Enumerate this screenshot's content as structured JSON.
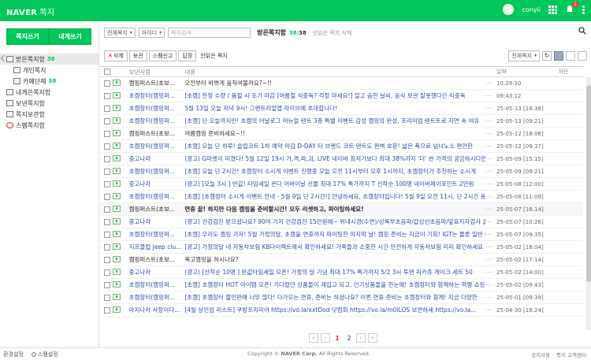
{
  "header": {
    "logo": "NAVER",
    "service": "쪽지",
    "username": "conyii",
    "notification_count": "1",
    "app_icon": "grid-icon"
  },
  "sidebar": {
    "send_label": "쪽지쓰기",
    "self_label": "내게쓰기",
    "folders": [
      {
        "label": "받은쪽지함",
        "count": "38",
        "icon": "inbox-icon",
        "indent": 0,
        "selected": true
      },
      {
        "label": "개인쪽지",
        "count": "",
        "icon": "person-icon",
        "indent": 1
      },
      {
        "label": "카페단체",
        "count": "38",
        "icon": "group-icon",
        "indent": 1
      },
      {
        "label": "내게쓴쪽지함",
        "count": "",
        "icon": "self-icon",
        "indent": 0
      },
      {
        "label": "보낸쪽지함",
        "count": "",
        "icon": "sent-icon",
        "indent": 0
      },
      {
        "label": "쪽지보관함",
        "count": "",
        "icon": "archive-icon",
        "indent": 0
      },
      {
        "label": "스팸쪽지함",
        "count": "",
        "icon": "spam-icon",
        "indent": 0
      }
    ],
    "footer_settings": "환경설정",
    "footer_block": "스팸설정"
  },
  "filter": {
    "folder_select": "전체쪽지",
    "type_select": "아이디",
    "search_placeholder": "쪽지검색",
    "folder_title": "받은쪽지함",
    "unread": "38",
    "total": "38",
    "tip": "안읽은 쪽지 삭제"
  },
  "toolbar": {
    "delete_label": "삭제",
    "save_label": "보관",
    "spam_label": "스팸신고",
    "reply_label": "답장",
    "unread_label": "안읽은 쪽지",
    "view_select": "전체쪽지"
  },
  "table": {
    "headers": {
      "from": "보낸사람",
      "body": "내용",
      "date": "날짜",
      "block": "차단"
    },
    "rows": [
      {
        "from": "캠핑퍼스트(초보...",
        "body": "오전부터 바쁘게 움직여볼까요?~!!",
        "date": "10:29:10",
        "type": "shop"
      },
      {
        "from": "초캠장터(캠핑퍼...",
        "body": "[초캠] 한정 수량 / 품절 시 조기 마감 [여름철 식중독? 걱정 마세요!] 얼고 숨한 날씨, 음식 보관 잘못했다간 식중독",
        "date": "09:43:12",
        "type": "ad"
      },
      {
        "from": "초캠장터(캠핑퍼...",
        "body": "5월 13일 오늘 저녁 9시! 그랜트리얼앱 라이브에 초대합니다!",
        "date": "25-05-13 [16:38]",
        "type": "ad"
      },
      {
        "from": "초캠장터(캠핑퍼...",
        "body": "[초캠] 단 오늘까지만! 초캠의 어날로그 머뉴얼 텐트 3종 특별 이벤트 감성 캠핑의 완성, 프리미엄 텐트트로 자연 속 여유",
        "date": "25-05-13 [09:21]",
        "type": "ad"
      },
      {
        "from": "캠핑퍼스트(초보...",
        "body": "여름캠핑 준비하세요~!!",
        "date": "25-05-12 [18:06]",
        "type": "shop"
      },
      {
        "from": "초캠장터(캠핑퍼...",
        "body": "[초캠] 오늘 단 하루! 슬립코트 1차 예약 마감 D-DAY 타 브랜드 코트 텐트도 완벽 호환! 넓은 폭으로 넘녀노소 편안한",
        "date": "25-05-12 [09:37]",
        "type": "ad"
      },
      {
        "from": "중고나라",
        "body": "(광고) G마켓이 미쳤다! 5월 12일 19시 가,격,파,괴, LIVE 네이버 최저가보다 최대 38%까지 '더' 싼 가격의 궁금하시다면?!",
        "date": "25-05-09 [15:15]",
        "type": "ad"
      },
      {
        "from": "초캠장터(캠핑퍼...",
        "body": "[초캠] 오늘 단 2시간! 초캠장터 소시게 이벤트 진행중 오늘 오전 11시부터 오후 1시까지, 초캠장터가 추천하는 소시게",
        "date": "25-05-09 [09:21]",
        "type": "ad"
      },
      {
        "from": "중고나라",
        "body": "(광고) [오늘 3시 ] 반값! 타임세일 온다 어버이날 선물 최대 17% 특가까지 T 선착순 100명 네이버페이포인트 2만원",
        "date": "25-05-08 [12:00]",
        "type": "ad"
      },
      {
        "from": "초캠장터(캠핑퍼...",
        "body": "[초캠] [초캠장터 소시게 이벤트 안내 - 5월 9일 단 2시간!] 안녕하세요, 초캠장터입니다! 5월 9일 오전 11시, 단 2시간 동",
        "date": "25-05-08 [11:09]",
        "type": "ad"
      },
      {
        "from": "캠핑퍼스트(초보...",
        "body": "연휴 끝! 하지만 다음 캠핑을 준비할시간! 모두 리셋하고, 파이팅하세요!",
        "date": "25-05-07 [16:14]",
        "type": "bold"
      },
      {
        "from": "중고나라",
        "body": "(광고) 건강검진 받으셨나요? 90여 가지 건강검진 15만원에~ 위내시경(수면)/상복부초음파/갑상선초음파/앞표지자검사 골",
        "date": "25-05-07 [10:26]",
        "type": "ad"
      },
      {
        "from": "초캠장터(캠핑퍼...",
        "body": "[초캠] 우리도 캠핑 가자! 5월 가정의달, 초캠을 연휴까지 파이팅한 마지막 날! 캠핑 준비는 지금이 기회! IGT는 물론 일반 테이",
        "date": "25-05-07 [09:35]",
        "type": "ad"
      },
      {
        "from": "지프클럽 Jeep clu...",
        "body": "[광고] 가정의달 내 자동차보험 KB다이렉트에서 확인하세요! 가족들과 소중한 시간 안전하게 자동차보험 미리 확인하세요",
        "date": "25-05-02 [18:04]",
        "type": "ad"
      },
      {
        "from": "캠핑퍼스트(초보...",
        "body": "복고캠핑을 하시나요?",
        "date": "25-05-02 [17:14]",
        "type": "shop"
      },
      {
        "from": "중고나라",
        "body": "(광고) [선착순 10명 ] 반값타임세일 오픈! 가정의 달 기념 최대 17% 특가까지 5/2 3시 투엔 피카츄 게이크 세트 50",
        "date": "25-05-02 [14:00]",
        "type": "ad"
      },
      {
        "from": "초캠장터(캠핑퍼...",
        "body": "[초캠] 초캠장터 HOT 아이템 오픈! 기다렸던 상품들이 재입고 되고, 인기상품들을 한눈에! 초캠장터와 함께하는 혁명 쇼핑",
        "date": "25-05-02 [09:43]",
        "type": "ad"
      },
      {
        "from": "초캠장터(캠핑퍼...",
        "body": "[초캠] 초캠장터 할인판매 너무 많다! 다가오는 연휴, 준비는 하셨나요? 이번 연휴 준비는 초캠장터와 함께! 지금 다양한",
        "date": "25-05-01 [09:39]",
        "type": "ad"
      },
      {
        "from": "아지나라 사장이다...",
        "body": "[4월 상인섬 리스트] 쿠방프리미어 https://vo.la/xxtDod 닷컴회 https://vo.la/m0lLOS 보면하세 https://vo.la...",
        "date": "25-04-30 [16:24]",
        "type": "ad"
      }
    ]
  },
  "pager": {
    "first": "«",
    "prev": "‹",
    "pages": [
      "1",
      "2"
    ],
    "current": "1",
    "next": "›",
    "last": "»"
  },
  "footer": {
    "copyright_prefix": "Copyright ©",
    "company": "NAVER Corp.",
    "rights": "All Rights Reserved.",
    "links": [
      "공지사항",
      "쪽지 고객센터"
    ]
  },
  "colors": {
    "brand": "#03c75a",
    "ad_text": "#2a4da8",
    "current_page": "#e33333"
  }
}
